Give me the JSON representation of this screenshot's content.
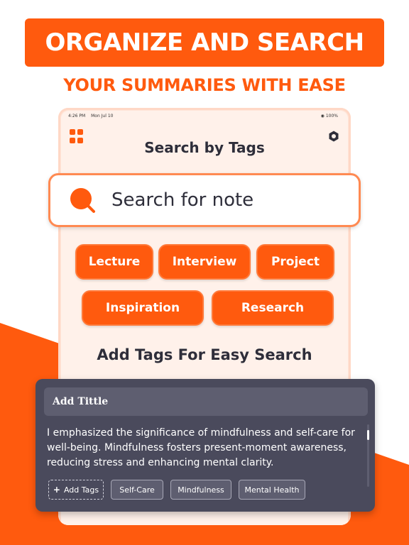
{
  "banner": {
    "title": "ORGANIZE AND SEARCH"
  },
  "subtitle": "YOUR SUMMARIES WITH EASE",
  "status_bar": {
    "time": "4:26 PM",
    "date": "Mon Jul 10",
    "battery": "100%"
  },
  "device": {
    "title": "Search by Tags",
    "menu_icon": "grid-menu-icon",
    "settings_icon": "gear-icon"
  },
  "search": {
    "placeholder": "Search for note",
    "icon": "search-icon"
  },
  "tags": [
    "Lecture",
    "Interview",
    "Project",
    "Inspiration",
    "Research"
  ],
  "section_heading": "Add Tags For Easy Search",
  "note": {
    "title_placeholder": "Add Tittle",
    "body": "I emphasized the significance of mindfulness and self-care for well-being. Mindfulness fosters present-moment awareness, reducing stress and enhancing mental clarity.",
    "add_tags_label": "Add Tags",
    "chips": [
      "Self-Care",
      "Mindfulness",
      "Mental Health"
    ]
  },
  "colors": {
    "accent": "#FF5A0E",
    "dark_text": "#2E2E3A",
    "card_bg": "#4A4A5C",
    "device_bg": "#FFF1EA"
  }
}
